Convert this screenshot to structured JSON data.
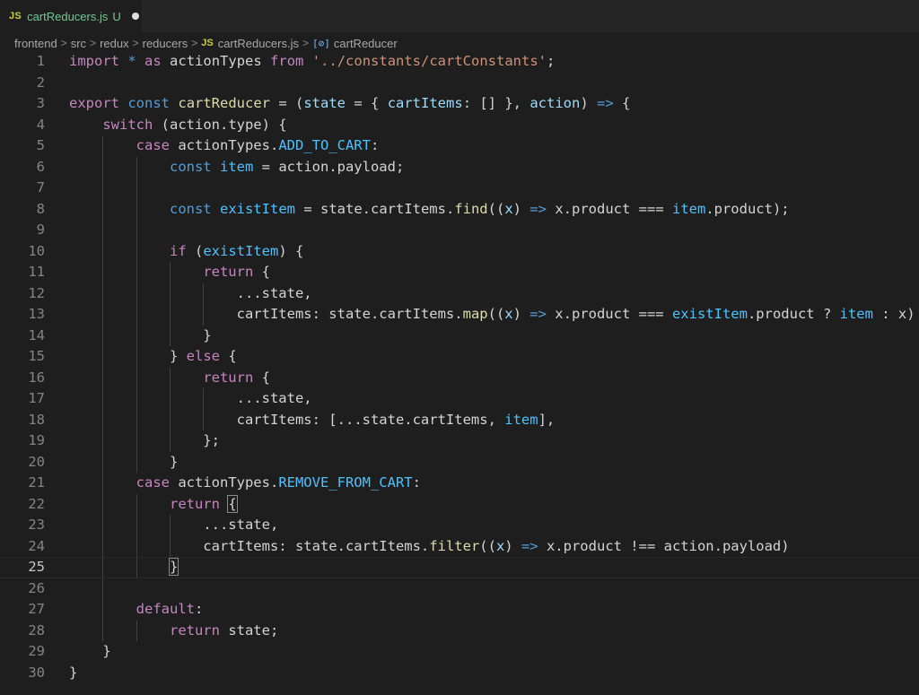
{
  "tab": {
    "file_icon": "JS",
    "title": "cartReducers.js",
    "status": "U"
  },
  "breadcrumb": {
    "items": [
      "frontend",
      "src",
      "redux",
      "reducers",
      "cartReducers.js",
      "cartReducer"
    ],
    "file_icon": "JS",
    "symbol_icon": "[⊘]"
  },
  "editor": {
    "active_line": 25,
    "lines": [
      [
        [
          "kw",
          "import"
        ],
        [
          "plain",
          " "
        ],
        [
          "st",
          "*"
        ],
        [
          "plain",
          " "
        ],
        [
          "kw",
          "as"
        ],
        [
          "plain",
          " actionTypes "
        ],
        [
          "kw",
          "from"
        ],
        [
          "plain",
          " "
        ],
        [
          "str",
          "'../constants/cartConstants'"
        ],
        [
          "plain",
          ";"
        ]
      ],
      [],
      [
        [
          "kw",
          "export"
        ],
        [
          "plain",
          " "
        ],
        [
          "st",
          "const"
        ],
        [
          "plain",
          " "
        ],
        [
          "fn",
          "cartReducer"
        ],
        [
          "plain",
          " = ("
        ],
        [
          "var",
          "state"
        ],
        [
          "plain",
          " = { "
        ],
        [
          "var",
          "cartItems"
        ],
        [
          "plain",
          ": [] }, "
        ],
        [
          "var",
          "action"
        ],
        [
          "plain",
          ") "
        ],
        [
          "st",
          "=>"
        ],
        [
          "plain",
          " {"
        ]
      ],
      [
        [
          "plain",
          "    "
        ],
        [
          "kw",
          "switch"
        ],
        [
          "plain",
          " (action.type) {"
        ]
      ],
      [
        [
          "plain",
          "        "
        ],
        [
          "kw",
          "case"
        ],
        [
          "plain",
          " actionTypes."
        ],
        [
          "cst",
          "ADD_TO_CART"
        ],
        [
          "plain",
          ":"
        ]
      ],
      [
        [
          "plain",
          "            "
        ],
        [
          "st",
          "const"
        ],
        [
          "plain",
          " "
        ],
        [
          "cst",
          "item"
        ],
        [
          "plain",
          " = action.payload;"
        ]
      ],
      [],
      [
        [
          "plain",
          "            "
        ],
        [
          "st",
          "const"
        ],
        [
          "plain",
          " "
        ],
        [
          "cst",
          "existItem"
        ],
        [
          "plain",
          " = state.cartItems."
        ],
        [
          "fn",
          "find"
        ],
        [
          "plain",
          "(("
        ],
        [
          "var",
          "x"
        ],
        [
          "plain",
          ") "
        ],
        [
          "st",
          "=>"
        ],
        [
          "plain",
          " x.product === "
        ],
        [
          "cst",
          "item"
        ],
        [
          "plain",
          ".product);"
        ]
      ],
      [],
      [
        [
          "plain",
          "            "
        ],
        [
          "kw",
          "if"
        ],
        [
          "plain",
          " ("
        ],
        [
          "cst",
          "existItem"
        ],
        [
          "plain",
          ") {"
        ]
      ],
      [
        [
          "plain",
          "                "
        ],
        [
          "kw",
          "return"
        ],
        [
          "plain",
          " {"
        ]
      ],
      [
        [
          "plain",
          "                    ...state,"
        ]
      ],
      [
        [
          "plain",
          "                    cartItems: state.cartItems."
        ],
        [
          "fn",
          "map"
        ],
        [
          "plain",
          "(("
        ],
        [
          "var",
          "x"
        ],
        [
          "plain",
          ") "
        ],
        [
          "st",
          "=>"
        ],
        [
          "plain",
          " x.product === "
        ],
        [
          "cst",
          "existItem"
        ],
        [
          "plain",
          ".product ? "
        ],
        [
          "cst",
          "item"
        ],
        [
          "plain",
          " : x)"
        ]
      ],
      [
        [
          "plain",
          "                }"
        ]
      ],
      [
        [
          "plain",
          "            } "
        ],
        [
          "kw",
          "else"
        ],
        [
          "plain",
          " {"
        ]
      ],
      [
        [
          "plain",
          "                "
        ],
        [
          "kw",
          "return"
        ],
        [
          "plain",
          " {"
        ]
      ],
      [
        [
          "plain",
          "                    ...state,"
        ]
      ],
      [
        [
          "plain",
          "                    cartItems: [...state.cartItems, "
        ],
        [
          "cst",
          "item"
        ],
        [
          "plain",
          "],"
        ]
      ],
      [
        [
          "plain",
          "                };"
        ]
      ],
      [
        [
          "plain",
          "            }"
        ]
      ],
      [
        [
          "plain",
          "        "
        ],
        [
          "kw",
          "case"
        ],
        [
          "plain",
          " actionTypes."
        ],
        [
          "cst",
          "REMOVE_FROM_CART"
        ],
        [
          "plain",
          ":"
        ]
      ],
      [
        [
          "plain",
          "            "
        ],
        [
          "kw",
          "return"
        ],
        [
          "plain",
          " "
        ],
        [
          "brk",
          "{"
        ]
      ],
      [
        [
          "plain",
          "                ...state,"
        ]
      ],
      [
        [
          "plain",
          "                cartItems: state.cartItems."
        ],
        [
          "fn",
          "filter"
        ],
        [
          "plain",
          "(("
        ],
        [
          "var",
          "x"
        ],
        [
          "plain",
          ") "
        ],
        [
          "st",
          "=>"
        ],
        [
          "plain",
          " x.product !== action.payload)"
        ]
      ],
      [
        [
          "plain",
          "            "
        ],
        [
          "brk",
          "}"
        ]
      ],
      [],
      [
        [
          "plain",
          "        "
        ],
        [
          "kw",
          "default"
        ],
        [
          "plain",
          ":"
        ]
      ],
      [
        [
          "plain",
          "            "
        ],
        [
          "kw",
          "return"
        ],
        [
          "plain",
          " state;"
        ]
      ],
      [
        [
          "plain",
          "    }"
        ]
      ],
      [
        [
          "plain",
          "}"
        ]
      ]
    ]
  },
  "colors": {
    "background": "#1e1e1e",
    "keyword": "#c586c0",
    "storage": "#569cd6",
    "function": "#dcdcaa",
    "parameter": "#9cdcfe",
    "constant": "#4fc1ff",
    "string": "#ce9178",
    "text": "#d4d4d4"
  }
}
